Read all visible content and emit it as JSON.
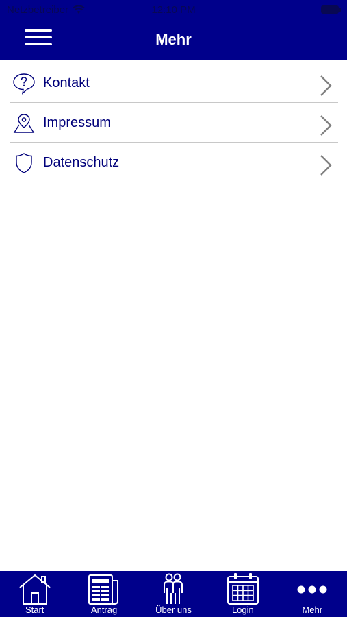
{
  "status_bar": {
    "carrier": "Netzbetreiber",
    "time": "12:10 PM"
  },
  "header": {
    "title": "Mehr",
    "background": "#00008b"
  },
  "menu": {
    "items": [
      {
        "label": "Kontakt",
        "icon": "question-bubble-icon"
      },
      {
        "label": "Impressum",
        "icon": "location-pin-icon"
      },
      {
        "label": "Datenschutz",
        "icon": "shield-icon"
      }
    ]
  },
  "tabbar": {
    "tabs": [
      {
        "label": "Start",
        "icon": "home-icon"
      },
      {
        "label": "Antrag",
        "icon": "newspaper-icon"
      },
      {
        "label": "Über uns",
        "icon": "people-icon"
      },
      {
        "label": "Login",
        "icon": "calendar-icon"
      },
      {
        "label": "Mehr",
        "icon": "more-dots-icon"
      }
    ],
    "active": "Mehr"
  },
  "colors": {
    "brand": "#00008b",
    "text": "#00007a",
    "divider": "#c8c8c8"
  }
}
